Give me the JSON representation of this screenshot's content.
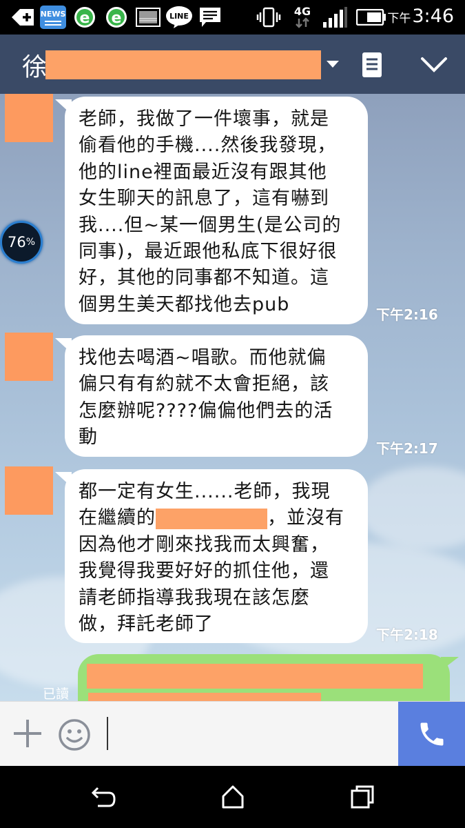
{
  "status_bar": {
    "time_prefix": "下午",
    "time": "3:46",
    "network": "4G",
    "news_label": "NEWS",
    "line_label": "LINE",
    "icons": [
      "add-icon",
      "news-app-icon",
      "ie-icon",
      "ie-icon",
      "image-icon",
      "line-app-icon",
      "message-icon",
      "vibrate-icon",
      "network-4g-icon",
      "signal-icon",
      "battery-icon"
    ]
  },
  "header": {
    "contact_initial": "徐",
    "icons": [
      "dropdown-caret-icon",
      "notes-icon",
      "chevron-down-icon"
    ]
  },
  "battery_widget": {
    "value": "76",
    "unit": "%"
  },
  "messages": [
    {
      "sender": "incoming",
      "lines": [
        "老師，我做了一件壞事，就是",
        "偷看他的手機....然後我發現，",
        "他的line裡面最近沒有跟其他",
        "女生聊天的訊息了，這有嚇到",
        "我....但~某一個男生(是公司的",
        "同事)，最近跟他私底下很好很",
        "好，其他的同事都不知道。這",
        "個男生美天都找他去pub"
      ],
      "time": "下午2:16"
    },
    {
      "sender": "incoming",
      "lines": [
        "找他去喝酒~唱歌。而他就偏",
        "偏只有有約就不太會拒絕，該",
        "怎麼辦呢????偏偏他們去的活",
        "動"
      ],
      "time": "下午2:17"
    },
    {
      "sender": "incoming",
      "lines_before": [
        "都一定有女生......老師，我現"
      ],
      "line_redacted_prefix": "在繼續的",
      "line_redacted_suffix": "，並沒有",
      "lines_after": [
        "因為他才剛來找我而太興奮，",
        "我覺得我要好好的抓住他，還",
        "請老師指導我我現在該怎麼",
        "做，拜託老師了"
      ],
      "time": "下午2:18"
    }
  ],
  "outgoing": {
    "read_label": "已讀"
  },
  "input_bar": {
    "icons": [
      "plus-icon",
      "emoji-icon",
      "phone-icon"
    ]
  },
  "nav_bar": {
    "icons": [
      "back-icon",
      "home-icon",
      "recents-icon"
    ]
  },
  "colors": {
    "header": "#3a4a66",
    "redaction": "#fda267",
    "outgoing_bubble": "#9be07a",
    "call_button": "#5a7fdf"
  }
}
